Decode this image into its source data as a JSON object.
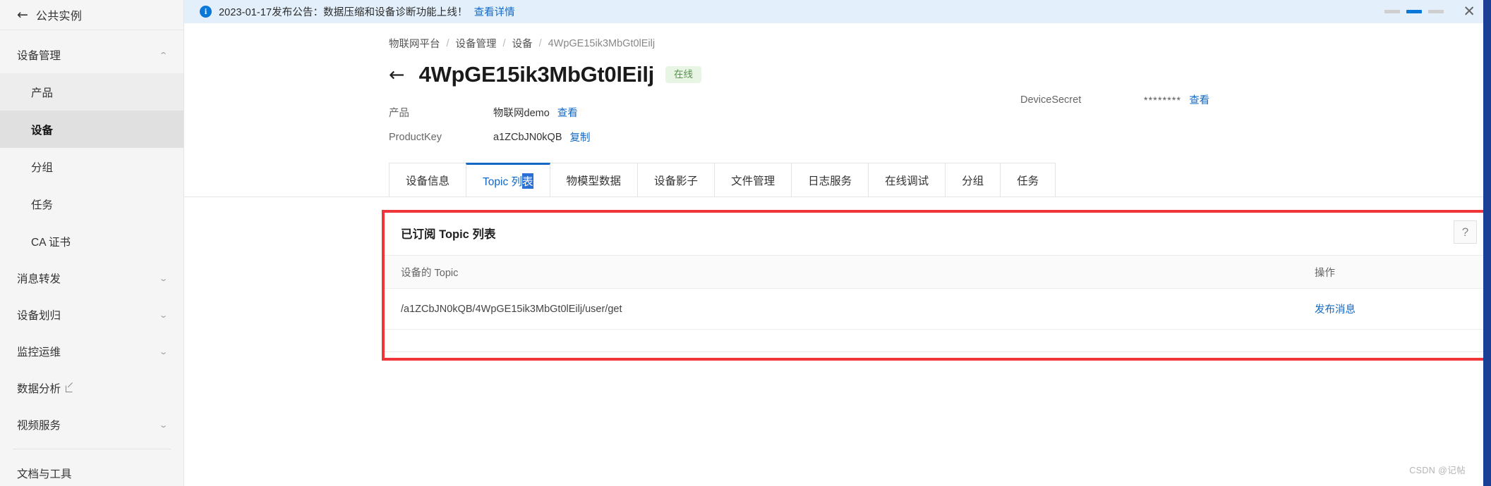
{
  "sidebar": {
    "instance": {
      "label": "公共实例",
      "back_icon": "arrow-left-icon"
    },
    "groups": [
      {
        "label": "设备管理",
        "expanded": true,
        "chevron": "chevron-up-icon",
        "items": [
          {
            "label": "产品",
            "state": "hovered"
          },
          {
            "label": "设备",
            "state": "active"
          },
          {
            "label": "分组",
            "state": "normal"
          },
          {
            "label": "任务",
            "state": "normal"
          },
          {
            "label": "CA 证书",
            "state": "normal"
          }
        ]
      },
      {
        "label": "消息转发",
        "expanded": false,
        "chevron": "chevron-down-icon",
        "items": []
      },
      {
        "label": "设备划归",
        "expanded": false,
        "chevron": "chevron-down-icon",
        "items": []
      },
      {
        "label": "监控运维",
        "expanded": false,
        "chevron": "chevron-down-icon",
        "items": []
      }
    ],
    "external_link": {
      "label": "数据分析",
      "icon": "external-link-icon"
    },
    "video_group": {
      "label": "视频服务",
      "chevron": "chevron-down-icon"
    },
    "docs": {
      "label": "文档与工具"
    }
  },
  "notice": {
    "icon": "info-circle-icon",
    "text": "2023-01-17发布公告：数据压缩和设备诊断功能上线！",
    "link": "查看详情",
    "carousel": {
      "count": 3,
      "active_index": 1
    },
    "close_icon": "close-icon"
  },
  "breadcrumb": {
    "items": [
      "物联网平台",
      "设备管理",
      "设备",
      "4WpGE15ik3MbGt0lEilj"
    ],
    "separator": "/"
  },
  "header": {
    "back_icon": "arrow-left-icon",
    "title": "4WpGE15ik3MbGt0lEilj",
    "status": "在线",
    "status_color": "#5a9152",
    "status_bg": "#e8f5e4"
  },
  "device_info": {
    "product_label": "产品",
    "product_value": "物联网demo",
    "product_link": "查看",
    "productkey_label": "ProductKey",
    "productkey_value": "a1ZCbJN0kQB",
    "productkey_link": "复制",
    "secret_label": "DeviceSecret",
    "secret_value": "********",
    "secret_link": "查看"
  },
  "tabs": [
    {
      "label": "设备信息",
      "active": false
    },
    {
      "label": "Topic 列",
      "active": true,
      "selected_suffix": "表"
    },
    {
      "label": "物模型数据",
      "active": false
    },
    {
      "label": "设备影子",
      "active": false
    },
    {
      "label": "文件管理",
      "active": false
    },
    {
      "label": "日志服务",
      "active": false
    },
    {
      "label": "在线调试",
      "active": false
    },
    {
      "label": "分组",
      "active": false
    },
    {
      "label": "任务",
      "active": false
    }
  ],
  "panel": {
    "title": "已订阅 Topic 列表",
    "columns": [
      "设备的 Topic",
      "操作"
    ],
    "rows": [
      {
        "topic": "/a1ZCbJN0kQB/4WpGE15ik3MbGt0lEilj/user/get",
        "action": "发布消息"
      }
    ]
  },
  "help_button": {
    "icon": "question-mark-icon",
    "label": "?"
  },
  "watermark": "CSDN @记帖",
  "accent_color": "#1268c3",
  "annotation_color": "#f0353a"
}
